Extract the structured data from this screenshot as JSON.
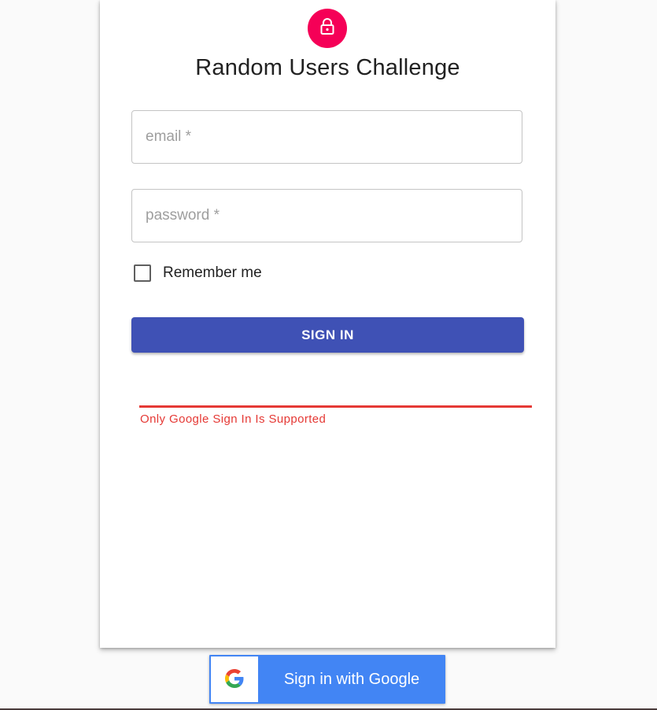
{
  "app": {
    "title": "Random Users Challenge",
    "icon": "lock-icon",
    "accent_color": "#f50057"
  },
  "form": {
    "email": {
      "placeholder": "email *",
      "value": ""
    },
    "password": {
      "placeholder": "password *",
      "value": ""
    },
    "remember": {
      "label": "Remember me",
      "checked": false
    },
    "submit_label": "SIGN IN",
    "submit_color": "#3f51b5"
  },
  "error": {
    "message": "Only Google Sign In Is Supported",
    "color": "#e53935"
  },
  "google": {
    "label": "Sign in with Google",
    "icon": "google-logo-icon",
    "color": "#4285f4"
  }
}
